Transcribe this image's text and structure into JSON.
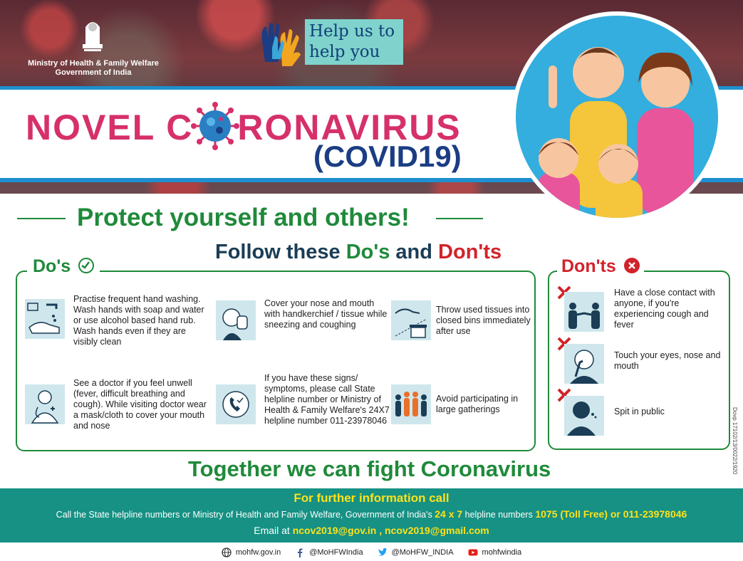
{
  "header": {
    "ministry_line1": "Ministry of Health & Family Welfare",
    "ministry_line2": "Government of India",
    "help_line1": "Help us to",
    "help_line2": "help you",
    "title_part1": "NOVEL C",
    "title_part2": "RONAVIRUS",
    "title_sub": "(COVID19)"
  },
  "protect_heading": "Protect yourself and others!",
  "follow": {
    "prefix": "Follow these ",
    "dos": "Do's",
    "mid": " and ",
    "donts": "Don'ts"
  },
  "dos": {
    "title": "Do's",
    "items": [
      {
        "icon": "hand-wash-icon",
        "text": "Practise frequent hand washing. Wash hands with soap and water or use alcohol based hand rub. Wash hands even if they are visibly clean"
      },
      {
        "icon": "cover-mouth-icon",
        "text": "Cover your nose and mouth with handkerchief / tissue while sneezing and coughing"
      },
      {
        "icon": "dustbin-icon",
        "text": "Throw used tissues into closed bins immediately after use"
      },
      {
        "icon": "doctor-icon",
        "text": "See a doctor if you feel unwell (fever, difficult breathing and cough). While visiting doctor wear a mask/cloth to cover your mouth and nose"
      },
      {
        "icon": "phone-helpline-icon",
        "text": "If you have these signs/ symptoms, please call State helpline number or Ministry of Health & Family Welfare's 24X7 helpline number 011-23978046"
      },
      {
        "icon": "crowd-icon",
        "text": "Avoid participating in large gatherings"
      }
    ]
  },
  "donts": {
    "title": "Don'ts",
    "items": [
      {
        "icon": "close-contact-icon",
        "text": "Have a close contact with anyone, if you're experiencing cough and fever"
      },
      {
        "icon": "touch-face-icon",
        "text": "Touch your eyes, nose and mouth"
      },
      {
        "icon": "spit-icon",
        "text": "Spit in public"
      }
    ]
  },
  "together": "Together we can fight Coronavirus",
  "doc_code": "Dovp 17102/13/0022/1920",
  "footer": {
    "line1": "For further information call",
    "line2_a": "Call the State helpline numbers or Ministry of Health and Family Welfare, Government of India's ",
    "line2_b": "24 x 7",
    "line2_c": " helpline numbers ",
    "line2_d": "1075 (Toll Free) or 011-23978046",
    "line3_a": "Email at ",
    "line3_b": "ncov2019@gov.in , ncov2019@gmail.com"
  },
  "social": {
    "web": "mohfw.gov.in",
    "facebook": "@MoHFWIndia",
    "twitter": "@MoHFW_INDIA",
    "youtube": "mohfwindia"
  },
  "colors": {
    "pink": "#d6306b",
    "navy": "#1b3d84",
    "green": "#1f8a3a",
    "red": "#d2232a",
    "teal": "#169184",
    "yellow": "#ffe21a",
    "blue": "#1e8fcf"
  }
}
